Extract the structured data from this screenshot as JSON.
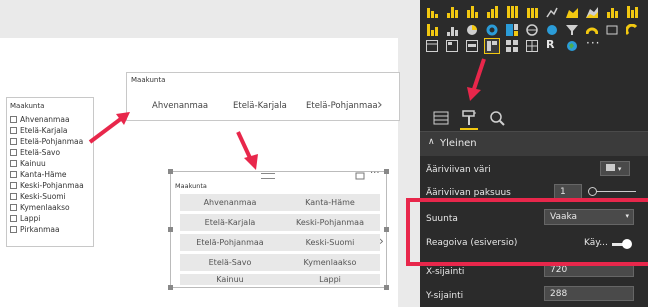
{
  "colors": {
    "accent": "#f2c811",
    "highlight": "#e8274b",
    "arrow": "#e8274b",
    "panel": "#2b2b2b"
  },
  "visualizations": {
    "icon_names": [
      "stacked-bar-icon",
      "stacked-column-icon",
      "clustered-bar-icon",
      "clustered-column-icon",
      "100-bar-icon",
      "100-column-icon",
      "line-icon",
      "area-icon",
      "stacked-area-icon",
      "line-column-icon",
      "ribbon-icon",
      "waterfall-icon",
      "scatter-icon",
      "pie-icon",
      "donut-icon",
      "treemap-icon",
      "map-icon",
      "filled-map-icon",
      "funnel-icon",
      "gauge-icon",
      "card-icon",
      "table-icon",
      "matrix-icon",
      "slicer-icon",
      "multirow-card-icon",
      "kpi-icon",
      "globe-icon"
    ],
    "r_label": "R",
    "more": "···"
  },
  "tabs": [
    "fields-tab",
    "format-tab",
    "analytics-tab"
  ],
  "format": {
    "section": "Yleinen",
    "rows": [
      {
        "label": "Ääriviivan väri"
      },
      {
        "label": "Ääriviivan paksuus",
        "value": "1"
      },
      {
        "label": "Suunta",
        "value": "Vaaka"
      },
      {
        "label": "Reagoiva (esiversio)",
        "value": "Käy..."
      },
      {
        "label": "X-sijainti",
        "value": "720"
      },
      {
        "label": "Y-sijainti",
        "value": "288"
      }
    ]
  },
  "list_slicer": {
    "title": "Maakunta",
    "items": [
      "Ahvenanmaa",
      "Etelä-Karjala",
      "Etelä-Pohjanmaa",
      "Etelä-Savo",
      "Kainuu",
      "Kanta-Häme",
      "Keski-Pohjanmaa",
      "Keski-Suomi",
      "Kymenlaakso",
      "Lappi",
      "Pirkanmaa"
    ]
  },
  "horizontal_slicer": {
    "title": "Maakunta",
    "items": [
      "Ahvenanmaa",
      "Etelä-Karjala",
      "Etelä-Pohjanmaa"
    ],
    "next": "›"
  },
  "grid_slicer": {
    "title": "Maakunta",
    "items": [
      "Ahvenanmaa",
      "Kanta-Häme",
      "Etelä-Karjala",
      "Keski-Pohjanmaa",
      "Etelä-Pohjanmaa",
      "Keski-Suomi",
      "Etelä-Savo",
      "Kymenlaakso",
      "Kainuu",
      "Lappi"
    ],
    "next": "›",
    "more": "···"
  }
}
